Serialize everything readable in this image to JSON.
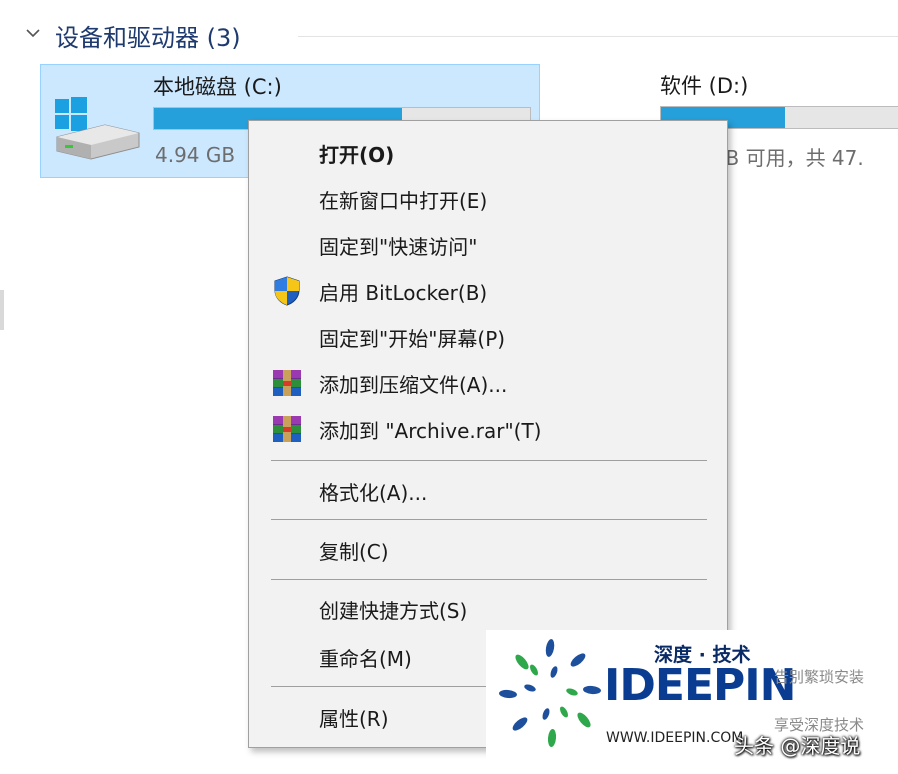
{
  "section": {
    "title": "设备和驱动器 (3)"
  },
  "drives": [
    {
      "name": "本地磁盘 (C:)",
      "info": "4.94 GB",
      "usage_fraction": 0.66
    },
    {
      "name": "软件 (D:)",
      "info": "GB 可用，共 47.",
      "usage_fraction": 0.5
    }
  ],
  "menu": {
    "items": [
      {
        "label": "打开(O)",
        "icon": null
      },
      {
        "label": "在新窗口中打开(E)",
        "icon": null
      },
      {
        "label": "固定到\"快速访问\"",
        "icon": null
      },
      {
        "label": "启用 BitLocker(B)",
        "icon": "shield-icon"
      },
      {
        "label": "固定到\"开始\"屏幕(P)",
        "icon": null
      },
      {
        "label": "添加到压缩文件(A)...",
        "icon": "winrar-icon"
      },
      {
        "label": "添加到 \"Archive.rar\"(T)",
        "icon": "winrar-icon"
      },
      {
        "label": "格式化(A)...",
        "icon": null
      },
      {
        "label": "复制(C)",
        "icon": null
      },
      {
        "label": "创建快捷方式(S)",
        "icon": null
      },
      {
        "label": "重命名(M)",
        "icon": null
      },
      {
        "label": "属性(R)",
        "icon": null
      }
    ]
  },
  "watermark": {
    "cn_name": "深度 · 技术",
    "brand": "IDEEPIN",
    "url": "WWW.IDEEPIN.COM",
    "slogan1": "告别繁琐安装",
    "slogan2": "享受深度技术",
    "credit": "头条 @深度说"
  },
  "colors": {
    "selection_bg": "#cce8ff",
    "selection_border": "#99d1ff",
    "bar_fill": "#26a0da",
    "menu_bg": "#f2f2f2",
    "header_text": "#1e3a6e"
  }
}
